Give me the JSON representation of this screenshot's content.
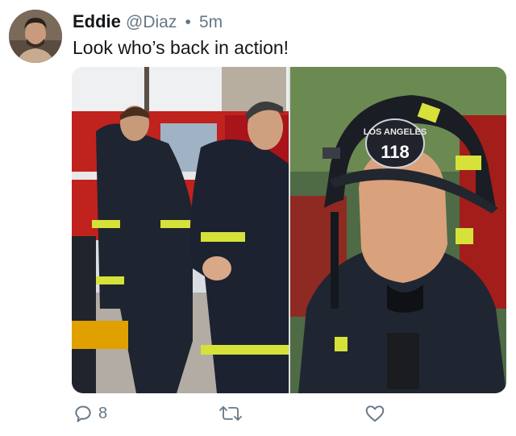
{
  "tweet": {
    "author": {
      "display_name": "Eddie",
      "handle": "@Diaz",
      "avatar_icon": "profile-photo"
    },
    "separator": "•",
    "timestamp": "5m",
    "text": "Look who’s back in action!",
    "media": [
      {
        "type": "photo",
        "name": "firefighters-photo"
      },
      {
        "type": "photo",
        "name": "firefighter-helmet-photo",
        "helmet_text": "LOS ANGELES",
        "helmet_number": "118"
      }
    ],
    "actions": {
      "reply_count": "8",
      "reply_icon": "reply-icon",
      "retweet_icon": "retweet-icon",
      "like_icon": "heart-icon"
    }
  },
  "colors": {
    "text_primary": "#14171a",
    "text_secondary": "#657786",
    "fire_truck_red": "#c0221d",
    "reflective_yellow": "#d6e23a"
  }
}
